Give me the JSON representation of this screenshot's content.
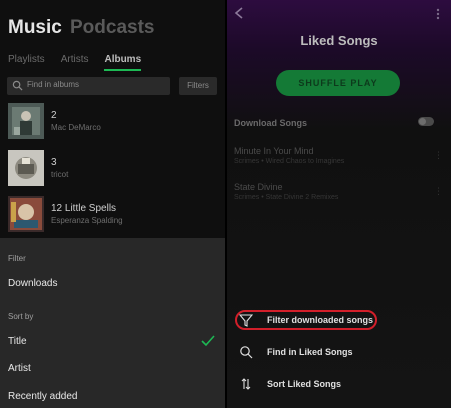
{
  "left": {
    "header": {
      "music": "Music",
      "podcasts": "Podcasts"
    },
    "subtabs": [
      "Playlists",
      "Artists",
      "Albums"
    ],
    "search": {
      "placeholder": "Find in albums"
    },
    "filters_label": "Filters",
    "albums": [
      {
        "title": "2",
        "artist": "Mac DeMarco"
      },
      {
        "title": "3",
        "artist": "tricot"
      },
      {
        "title": "12 Little Spells",
        "artist": "Esperanza Spalding"
      }
    ],
    "sheet": {
      "filter_label": "Filter",
      "downloads": "Downloads",
      "sortby_label": "Sort by",
      "options": [
        "Title",
        "Artist",
        "Recently added"
      ]
    }
  },
  "right": {
    "title": "Liked Songs",
    "shuffle_label": "SHUFFLE PLAY",
    "download_label": "Download Songs",
    "download_on": false,
    "songs": [
      {
        "title": "Minute In Your Mind",
        "subtitle": "Scrimes • Wired Chaos to Imagines"
      },
      {
        "title": "State Divine",
        "subtitle": "Scrimes • State Divine 2 Remixes"
      }
    ],
    "menu": [
      {
        "label": "Filter downloaded songs",
        "icon": "filter-icon",
        "highlighted": true
      },
      {
        "label": "Find in Liked Songs",
        "icon": "search-icon"
      },
      {
        "label": "Sort Liked Songs",
        "icon": "sort-icon"
      }
    ]
  },
  "colors": {
    "accent": "#1db954",
    "highlight": "#d21f2a"
  }
}
